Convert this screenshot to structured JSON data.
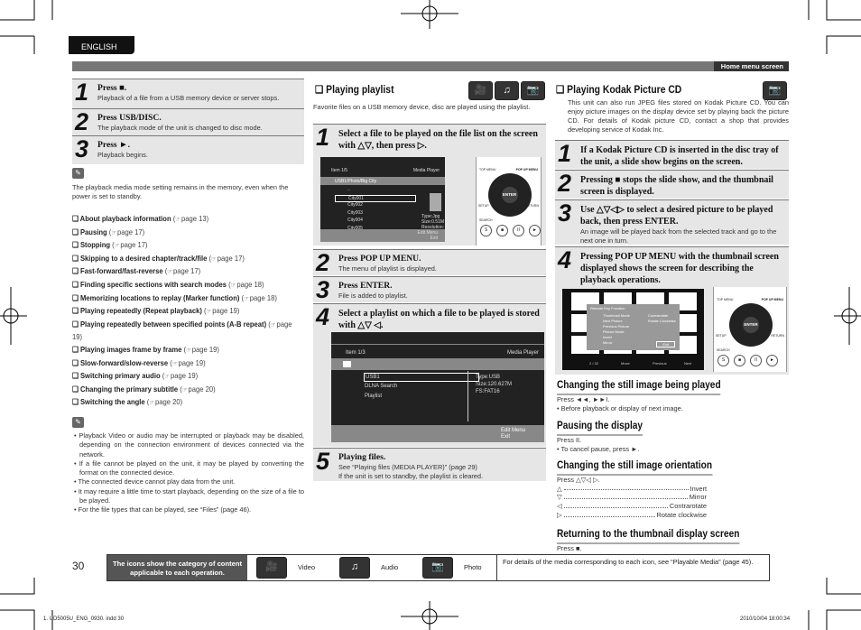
{
  "header": {
    "language": "ENGLISH",
    "section": "Home menu screen"
  },
  "left": {
    "steps": [
      {
        "num": "1",
        "title": "Press ■.",
        "desc": "Playback of a file from a USB memory device or server stops."
      },
      {
        "num": "2",
        "title": "Press USB/DISC.",
        "desc": "The playback mode of the unit is changed to disc mode."
      },
      {
        "num": "3",
        "title": "Press ►.",
        "desc": "Playback begins."
      }
    ],
    "note": "The playback media mode setting remains in the memory, even when the power is set to standby.",
    "links": [
      {
        "label": "About playback information",
        "ref": "page 13"
      },
      {
        "label": "Pausing",
        "ref": "page 17"
      },
      {
        "label": "Stopping",
        "ref": "page 17"
      },
      {
        "label": "Skipping to a desired chapter/track/file",
        "ref": "page 17"
      },
      {
        "label": "Fast-forward/fast-reverse",
        "ref": "page 17"
      },
      {
        "label": "Finding specific sections with search modes",
        "ref": "page 18"
      },
      {
        "label": "Memorizing locations to replay (Marker function)",
        "ref": "page 18"
      },
      {
        "label": "Playing repeatedly (Repeat playback)",
        "ref": "page 19"
      },
      {
        "label": "Playing repeatedly between specified points (A-B repeat)",
        "ref": "page 19"
      },
      {
        "label": "Playing images frame by frame",
        "ref": "page 19"
      },
      {
        "label": "Slow-forward/slow-reverse",
        "ref": "page 19"
      },
      {
        "label": "Switching primary audio",
        "ref": "page 19"
      },
      {
        "label": "Changing the primary subtitle",
        "ref": "page 20"
      },
      {
        "label": "Switching the angle",
        "ref": "page 20"
      }
    ],
    "notes": [
      "Playback Video or audio may be interrupted or playback may be disabled, depending on the connection environment of devices connected via the network.",
      "If a file cannot be played on the unit, it may be played by converting the format on the connected device.",
      "The connected device cannot play data from the unit.",
      "It may require a little time to start playback, depending on the size of a file to be played.",
      "For the file types that can be played, see “Files” (page 46)."
    ]
  },
  "middle": {
    "title": "Playing playlist",
    "intro": "Favorite files on a USB memory device, disc are played using the playlist.",
    "steps": [
      {
        "num": "1",
        "title": "Select a file to be played on the file list on the screen with △▽, then press ▷.",
        "desc": ""
      },
      {
        "num": "2",
        "title": "Press POP UP MENU.",
        "desc": "The menu of playlist is displayed."
      },
      {
        "num": "3",
        "title": "Press ENTER.",
        "desc": "File is added to playlist."
      },
      {
        "num": "4",
        "title": "Select a playlist on which a file to be played is stored with △▽ ◁.",
        "desc": ""
      },
      {
        "num": "5",
        "title": "Playing files.",
        "desc": "See “Playing files (MEDIA PLAYER)” (page 29)",
        "bullet": "If the unit is set to standby, the playlist is cleared."
      }
    ],
    "screen1": {
      "item": "Item 1/5",
      "app": "Media Player",
      "path": "USB1/Photo/Big City",
      "files": [
        "..",
        "City001",
        "City002",
        "City003",
        "City004",
        "City005"
      ],
      "info": [
        "Type:Jpg",
        "Size:0.51M",
        "Resolution:"
      ],
      "keys": [
        {
          "key": "POPUP",
          "label": "Edit Menu"
        },
        {
          "key": "RETURN",
          "label": "Exit"
        }
      ]
    },
    "screen2": {
      "item": "Item 1/3",
      "app": "Media Player",
      "files": [
        "USB1",
        "DLNA Search",
        "Playlist"
      ],
      "info": [
        "Type:USB",
        "Size:120.627M",
        "FS:FAT16"
      ],
      "keys": [
        {
          "key": "POPUP",
          "label": "Edit Menu"
        },
        {
          "key": "RETURN",
          "label": "Exit"
        }
      ]
    }
  },
  "remote": {
    "enter": "ENTER",
    "top_menu": "TOP MENU",
    "popup": "POP UP MENU",
    "setup": "SETUP",
    "return": "RETURN",
    "search": "SEARCH"
  },
  "right": {
    "title": "Playing Kodak Picture CD",
    "intro": "This unit can also run JPEG files stored on Kodak Picture CD. You can enjoy picture images on the display device set by playing back the picture CD. For details of Kodak picture CD, contact a shop that provides developing service of Kodak Inc.",
    "steps": [
      {
        "num": "1",
        "title": "If a Kodak Picture CD is inserted in the disc tray of the unit, a slide show begins on the screen.",
        "desc": ""
      },
      {
        "num": "2",
        "title": "Pressing ■ stops the slide show, and the thumbnail screen is displayed.",
        "desc": ""
      },
      {
        "num": "3",
        "title": "Use △▽◁▷ to select a desired picture to be played back, then press ENTER.",
        "desc": "An image will be played back from the selected track and go to the next one in turn."
      },
      {
        "num": "4",
        "title": "Pressing POP UP MENU with the thumbnail screen displayed shows the screen for describing the playback operations.",
        "desc": ""
      }
    ],
    "screen3": {
      "title": "Remote Key Function",
      "left": [
        "Thumbnail Mode",
        "Next Picture",
        "Previous Picture",
        "Picture Mode",
        "Invert",
        "Mirror"
      ],
      "right": [
        "Contrarotate",
        "Rotate Clockwise"
      ],
      "exit": "Exit",
      "counter": "2 / 32",
      "nav": [
        "Move",
        "Previous",
        "Next"
      ]
    },
    "sections": [
      {
        "title": "Changing the still image being played",
        "lines": [
          "Press ◄◄, ►►I.",
          "• Before playback or display of next image."
        ]
      },
      {
        "title": "Pausing the display",
        "lines": [
          "Press II.",
          "• To cancel pause, press ►."
        ]
      },
      {
        "title": "Changing the still image orientation",
        "lines": [
          "Press △▽◁ ▷."
        ]
      },
      {
        "title": "Returning to the thumbnail display screen",
        "lines": [
          "Press ■."
        ]
      }
    ],
    "orientation": [
      {
        "key": "△",
        "label": "Invert"
      },
      {
        "key": "▽",
        "label": "Mirror"
      },
      {
        "key": "◁",
        "label": "Contrarotate"
      },
      {
        "key": "▷",
        "label": "Rotate clockwise"
      }
    ]
  },
  "footer": {
    "page": "30",
    "label": "The icons show the category of content applicable to each operation.",
    "categories": [
      {
        "icon": "video-icon",
        "label": "Video"
      },
      {
        "icon": "audio-icon",
        "label": "Audio"
      },
      {
        "icon": "photo-icon",
        "label": "Photo"
      }
    ],
    "info": "For details of the media corresponding to each icon, see “Playable Media” (page 45).",
    "file": "1. UD5005U_ENG_0930. indd   30",
    "date": "2010/10/04   18:00:34"
  }
}
